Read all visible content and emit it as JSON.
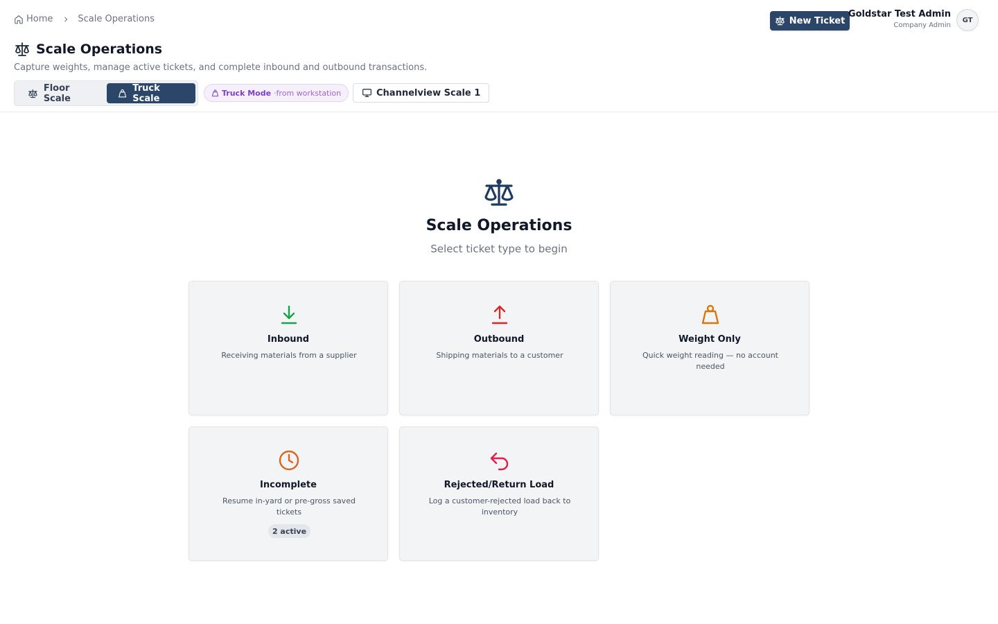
{
  "breadcrumb": {
    "home": "Home",
    "current": "Scale Operations"
  },
  "page": {
    "title": "Scale Operations",
    "subtitle": "Capture weights, manage active tickets, and complete inbound and outbound transactions."
  },
  "scale_toggle": {
    "options": [
      {
        "label": "Floor Scale",
        "icon": "scale-icon",
        "active": false
      },
      {
        "label": "Truck Scale",
        "icon": "weight-icon",
        "active": true
      }
    ]
  },
  "mode_pill": {
    "label": "Truck Mode",
    "source": "·from workstation",
    "color": "#7e3fc0"
  },
  "station": {
    "label": "Channelview Scale 1",
    "icon": "monitor-icon"
  },
  "new_ticket": {
    "label": "New Ticket",
    "icon": "scale-icon"
  },
  "user": {
    "name": "Goldstar Test Admin",
    "role": "Company Admin",
    "initials": "GT"
  },
  "hero": {
    "title": "Scale Operations",
    "subtitle": "Select ticket type to begin",
    "icon": "scale-icon"
  },
  "cards": [
    {
      "title": "Inbound",
      "description": "Receiving materials from a supplier",
      "icon": "download-arrow-icon",
      "color": "#16a34a"
    },
    {
      "title": "Outbound",
      "description": "Shipping materials to a customer",
      "icon": "upload-arrow-icon",
      "color": "#dc2626"
    },
    {
      "title": "Weight Only",
      "description": "Quick weight reading — no account needed",
      "icon": "weight-icon",
      "color": "#d97706"
    },
    {
      "title": "Incomplete",
      "description": "Resume in-yard or pre-gross saved tickets",
      "icon": "clock-icon",
      "color": "#e0621b",
      "badge": "2 active"
    },
    {
      "title": "Rejected/Return Load",
      "description": "Log a customer-rejected load back to inventory",
      "icon": "return-arrow-icon",
      "color": "#e11d48"
    }
  ],
  "colors": {
    "primary": "#2b4668",
    "muted_text": "#6b7280",
    "card_bg": "#f3f4f6"
  }
}
